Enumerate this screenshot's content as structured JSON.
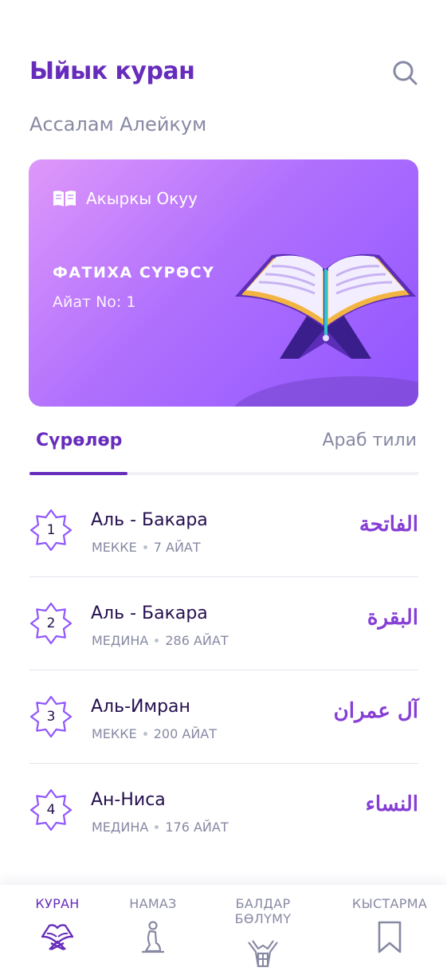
{
  "header": {
    "title": "Ыйык куран"
  },
  "greeting": "Ассалам Алейкум",
  "last_read": {
    "label": "Акыркы Окуу",
    "surah": "ФАТИХА СҮРӨСҮ",
    "ayah": "Айат No: 1"
  },
  "tabs": [
    {
      "label": "Сүрөлөр",
      "active": true
    },
    {
      "label": "Араб тили",
      "active": false
    }
  ],
  "surahs": [
    {
      "number": "1",
      "name": "Аль - Бакара",
      "place": "МЕККЕ",
      "ayahs": "7 АЙАТ",
      "arabic": "الفاتحة"
    },
    {
      "number": "2",
      "name": "Аль - Бакара",
      "place": "МЕДИНА",
      "ayahs": "286 АЙАТ",
      "arabic": "البقرة"
    },
    {
      "number": "3",
      "name": "Аль-Имран",
      "place": "МЕККЕ",
      "ayahs": "200 АЙАТ",
      "arabic": "آل عمران"
    },
    {
      "number": "4",
      "name": "Ан-Ниса",
      "place": "МЕДИНА",
      "ayahs": "176 АЙАТ",
      "arabic": "النساء"
    }
  ],
  "nav": [
    {
      "label": "КУРАН",
      "icon": "quran-icon",
      "active": true
    },
    {
      "label": "НАМАЗ",
      "icon": "prayer-icon",
      "active": false
    },
    {
      "label": "БАЛДАР БӨЛҮМҮ",
      "icon": "kids-icon",
      "active": false
    },
    {
      "label": "КЫСТАРМА",
      "icon": "bookmark-icon",
      "active": false
    }
  ],
  "colors": {
    "primary": "#672CBC",
    "text_dark": "#240F4F",
    "text_muted": "#8789A3",
    "arabic": "#863ED5",
    "card_gradient_start": "#DF98FA",
    "card_gradient_end": "#9055FF"
  }
}
